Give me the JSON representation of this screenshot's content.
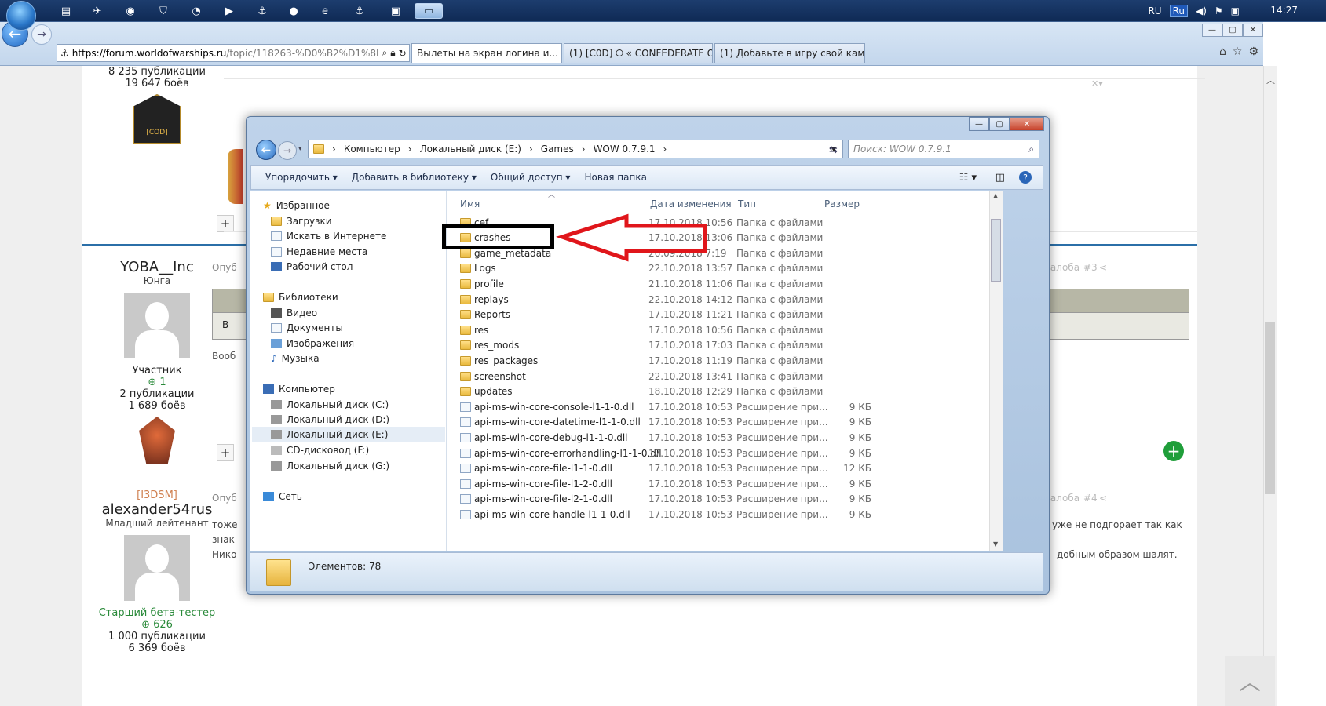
{
  "taskbar": {
    "tray_lang": "RU",
    "tray_lang_badge": "Ru",
    "clock": "14:27"
  },
  "browser": {
    "address_host": "https://forum.worldofwarships.ru",
    "address_path": "/topic/118263-%D0%B2%D1%8I",
    "tabs": [
      {
        "label": "Вылеты на экран логина и..."
      },
      {
        "label": "(1) [C0D] 🞅 « CONFEDERATE O..."
      },
      {
        "label": "(1) Добавьте в игру свой кам..."
      }
    ]
  },
  "forum": {
    "post0": {
      "pubs": "8 235 публикации",
      "battles": "19 647 боёв",
      "badge": "[COD]"
    },
    "post1": {
      "username": "YOBA__Inc",
      "rank": "Юнга",
      "group": "Участник",
      "rep": "1",
      "pubs": "2 публикации",
      "battles": "1 689 боёв",
      "body_prefix": "Опуб",
      "body_b": "В",
      "body_text": "Вооб",
      "report": "Жалоба",
      "num": "#3"
    },
    "post2": {
      "clan": "[I3DSM]",
      "username": "alexander54rus",
      "rank": "Младший лейтенант",
      "group": "Старший бета-тестер",
      "rep": "626",
      "pubs": "1 000 публикации",
      "battles": "6 369 боёв",
      "body_prefix": "Опуб",
      "line1_left": "тоже",
      "line2_left": "знак",
      "line3_left": "Нико",
      "line1_right": "уже не подгорает так как",
      "line3_right": "добным образом шалят.",
      "report": "Жалоба",
      "num": "#4"
    }
  },
  "explorer": {
    "breadcrumbs": [
      "Компьютер",
      "Локальный диск (E:)",
      "Games",
      "WOW 0.7.9.1"
    ],
    "search_placeholder": "Поиск: WOW 0.7.9.1",
    "toolbar": {
      "organize": "Упорядочить",
      "add_library": "Добавить в библиотеку",
      "share": "Общий доступ",
      "new_folder": "Новая папка"
    },
    "nav": {
      "favorites": "Избранное",
      "downloads": "Загрузки",
      "search_web": "Искать в Интернете",
      "recent": "Недавние места",
      "desktop": "Рабочий стол",
      "libraries": "Библиотеки",
      "video": "Видео",
      "documents": "Документы",
      "images": "Изображения",
      "music": "Музыка",
      "computer": "Компьютер",
      "drive_c": "Локальный диск (C:)",
      "drive_d": "Локальный диск (D:)",
      "drive_e": "Локальный диск (E:)",
      "drive_f": "CD-дисковод (F:)",
      "drive_g": "Локальный диск (G:)",
      "network": "Сеть"
    },
    "columns": {
      "name": "Имя",
      "date": "Дата изменения",
      "type": "Тип",
      "size": "Размер"
    },
    "files": [
      {
        "name": "cef",
        "date": "17.10.2018 10:56",
        "type": "Папка с файлами",
        "size": "",
        "kind": "folder"
      },
      {
        "name": "crashes",
        "date": "17.10.2018 13:06",
        "type": "Папка с файлами",
        "size": "",
        "kind": "folder"
      },
      {
        "name": "game_metadata",
        "date": "26.09.2018 7:19",
        "type": "Папка с файлами",
        "size": "",
        "kind": "folder"
      },
      {
        "name": "Logs",
        "date": "22.10.2018 13:57",
        "type": "Папка с файлами",
        "size": "",
        "kind": "folder"
      },
      {
        "name": "profile",
        "date": "21.10.2018 11:06",
        "type": "Папка с файлами",
        "size": "",
        "kind": "folder"
      },
      {
        "name": "replays",
        "date": "22.10.2018 14:12",
        "type": "Папка с файлами",
        "size": "",
        "kind": "folder"
      },
      {
        "name": "Reports",
        "date": "17.10.2018 11:21",
        "type": "Папка с файлами",
        "size": "",
        "kind": "folder"
      },
      {
        "name": "res",
        "date": "17.10.2018 10:56",
        "type": "Папка с файлами",
        "size": "",
        "kind": "folder"
      },
      {
        "name": "res_mods",
        "date": "17.10.2018 17:03",
        "type": "Папка с файлами",
        "size": "",
        "kind": "folder"
      },
      {
        "name": "res_packages",
        "date": "17.10.2018 11:19",
        "type": "Папка с файлами",
        "size": "",
        "kind": "folder"
      },
      {
        "name": "screenshot",
        "date": "22.10.2018 13:41",
        "type": "Папка с файлами",
        "size": "",
        "kind": "folder"
      },
      {
        "name": "updates",
        "date": "18.10.2018 12:29",
        "type": "Папка с файлами",
        "size": "",
        "kind": "folder"
      },
      {
        "name": "api-ms-win-core-console-l1-1-0.dll",
        "date": "17.10.2018 10:53",
        "type": "Расширение при...",
        "size": "9 КБ",
        "kind": "dll"
      },
      {
        "name": "api-ms-win-core-datetime-l1-1-0.dll",
        "date": "17.10.2018 10:53",
        "type": "Расширение при...",
        "size": "9 КБ",
        "kind": "dll"
      },
      {
        "name": "api-ms-win-core-debug-l1-1-0.dll",
        "date": "17.10.2018 10:53",
        "type": "Расширение при...",
        "size": "9 КБ",
        "kind": "dll"
      },
      {
        "name": "api-ms-win-core-errorhandling-l1-1-0.dll",
        "date": "17.10.2018 10:53",
        "type": "Расширение при...",
        "size": "9 КБ",
        "kind": "dll"
      },
      {
        "name": "api-ms-win-core-file-l1-1-0.dll",
        "date": "17.10.2018 10:53",
        "type": "Расширение при...",
        "size": "12 КБ",
        "kind": "dll"
      },
      {
        "name": "api-ms-win-core-file-l1-2-0.dll",
        "date": "17.10.2018 10:53",
        "type": "Расширение при...",
        "size": "9 КБ",
        "kind": "dll"
      },
      {
        "name": "api-ms-win-core-file-l2-1-0.dll",
        "date": "17.10.2018 10:53",
        "type": "Расширение при...",
        "size": "9 КБ",
        "kind": "dll"
      },
      {
        "name": "api-ms-win-core-handle-l1-1-0.dll",
        "date": "17.10.2018 10:53",
        "type": "Расширение при...",
        "size": "9 КБ",
        "kind": "dll"
      }
    ],
    "status": "Элементов: 78"
  },
  "colors": {
    "highlight_box": "#000000",
    "arrow": "#e0161b",
    "accent": "#2b6fa8"
  }
}
